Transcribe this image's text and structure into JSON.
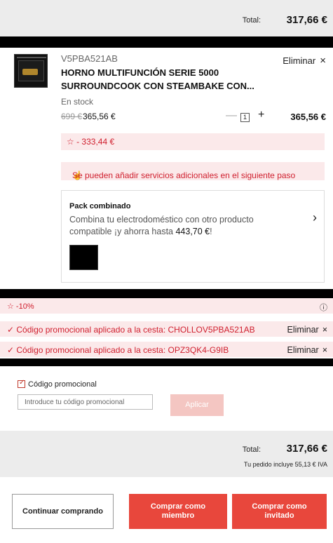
{
  "top_total": {
    "label": "Total:",
    "value": "317,66 €"
  },
  "product": {
    "sku": "V5PBA521AB",
    "remove_label": "Eliminar",
    "remove_icon": "×",
    "name": "HORNO MULTIFUNCIÓN SERIE 5000 SURROUNDCOOK CON STEAMBAKE CON...",
    "stock": "En stock",
    "old_price": "699 €",
    "price": "365,56 €",
    "qty_minus": "—",
    "quantity": "1",
    "qty_plus": "+",
    "line_total": "365,56 €",
    "discount": "☆ - 333,44 €",
    "services_note": "Se pueden añadir servicios adicionales en el siguiente paso",
    "pack": {
      "title": "Pack combinado",
      "desc_prefix": "Combina tu electrodoméstico con otro producto compatible ¡y ahorra hasta ",
      "desc_amount": "443,70 €",
      "desc_suffix": "!",
      "chevron": "›"
    }
  },
  "promotions": {
    "percent": "☆ -10%",
    "info_icon": "ⓘ",
    "codes": [
      {
        "text": "✓ Código promocional aplicado a la cesta: CHOLLOV5PBA521AB",
        "remove": "Eliminar",
        "x": "×"
      },
      {
        "text": "✓ Código promocional aplicado a la cesta: OPZ3QK4-G9IB",
        "remove": "Eliminar",
        "x": "×"
      }
    ]
  },
  "promo_input": {
    "checkbox_label": "Código promocional",
    "placeholder": "Introduce tu código promocional",
    "apply_label": "Aplicar"
  },
  "bottom_total": {
    "label": "Total:",
    "value": "317,66 €",
    "vat": "Tu pedido incluye 55,13 € IVA"
  },
  "actions": {
    "continue": "Continuar comprando",
    "member": "Comprar como miembro",
    "guest": "Comprar como invitado"
  },
  "colors": {
    "accent": "#e8473c",
    "alert_text": "#d0202f",
    "alert_bg": "#fbe9ea"
  }
}
